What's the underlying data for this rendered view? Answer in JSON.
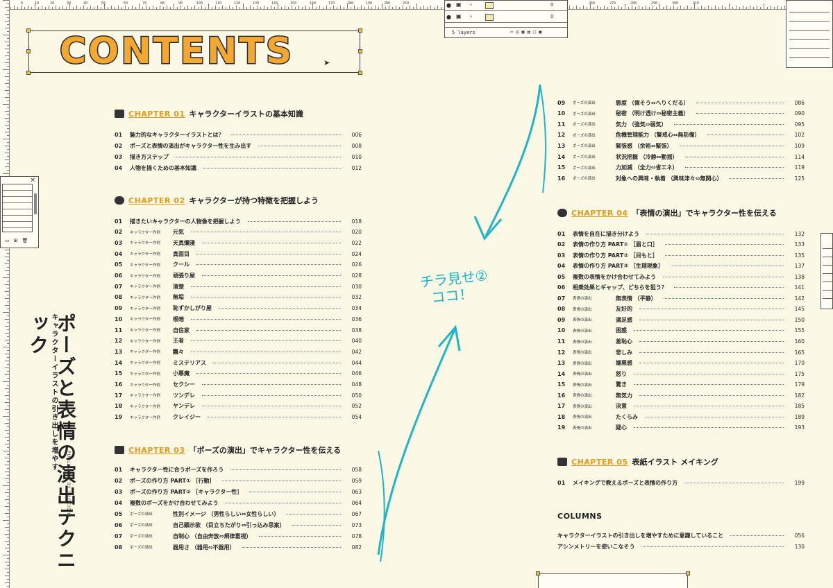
{
  "ruler": {
    "top_numbers": [
      "0",
      "10",
      "20",
      "30",
      "40",
      "50",
      "60",
      "70",
      "80",
      "90",
      "100",
      "110",
      "120",
      "130",
      "140",
      "150",
      "160",
      "170",
      "180",
      "190",
      "200",
      "250",
      "260",
      "270",
      "280",
      "290",
      "300",
      "310"
    ]
  },
  "layers_panel": {
    "rows": [
      {
        "number": "0"
      },
      {
        "number": "0"
      }
    ],
    "footer": "5 layers"
  },
  "left_window": {
    "close": "×"
  },
  "title": "CONTENTS",
  "side": {
    "sub": "キャラクターイラストの引き出しを増やす",
    "main": "ポーズと表情の演出テクニック",
    "publisher": "PUBLISHED BY SHOEISHA"
  },
  "annotation": {
    "line1": "チラ見せ②",
    "line2": "ココ！"
  },
  "chapters": [
    {
      "label": "CHAPTER 01",
      "title": "キャラクターイラストの基本知識",
      "items": [
        {
          "num": "01",
          "tag": "",
          "text": "魅力的なキャラクターイラストとは？",
          "page": "006"
        },
        {
          "num": "02",
          "tag": "",
          "text": "ポーズと表情の演出がキャラクター性を生み出す",
          "page": "008"
        },
        {
          "num": "03",
          "tag": "",
          "text": "描き方ステップ",
          "page": "010"
        },
        {
          "num": "04",
          "tag": "",
          "text": "人物を描くための基本知識",
          "page": "012"
        }
      ]
    },
    {
      "label": "CHAPTER 02",
      "title": "キャラクターが持つ特徴を把握しよう",
      "items": [
        {
          "num": "01",
          "tag": "",
          "text": "描きたいキャラクターの人物像を把握しよう",
          "page": "018"
        },
        {
          "num": "02",
          "tag": "キャラクター作例",
          "text": "元気",
          "page": "020"
        },
        {
          "num": "03",
          "tag": "キャラクター作例",
          "text": "天真爛漫",
          "page": "022"
        },
        {
          "num": "04",
          "tag": "キャラクター作例",
          "text": "真面目",
          "page": "024"
        },
        {
          "num": "05",
          "tag": "キャラクター作例",
          "text": "クール",
          "page": "026"
        },
        {
          "num": "06",
          "tag": "キャラクター作例",
          "text": "頑張り屋",
          "page": "028"
        },
        {
          "num": "07",
          "tag": "キャラクター作例",
          "text": "清楚",
          "page": "030"
        },
        {
          "num": "08",
          "tag": "キャラクター作例",
          "text": "無垢",
          "page": "032"
        },
        {
          "num": "09",
          "tag": "キャラクター作例",
          "text": "恥ずかしがり屋",
          "page": "034"
        },
        {
          "num": "10",
          "tag": "キャラクター作例",
          "text": "根暗",
          "page": "036"
        },
        {
          "num": "11",
          "tag": "キャラクター作例",
          "text": "自信家",
          "page": "038"
        },
        {
          "num": "12",
          "tag": "キャラクター作例",
          "text": "王者",
          "page": "040"
        },
        {
          "num": "13",
          "tag": "キャラクター作例",
          "text": "飄々",
          "page": "042"
        },
        {
          "num": "14",
          "tag": "キャラクター作例",
          "text": "ミステリアス",
          "page": "044"
        },
        {
          "num": "15",
          "tag": "キャラクター作例",
          "text": "小悪魔",
          "page": "046"
        },
        {
          "num": "16",
          "tag": "キャラクター作例",
          "text": "セクシー",
          "page": "048"
        },
        {
          "num": "17",
          "tag": "キャラクター作例",
          "text": "ツンデレ",
          "page": "050"
        },
        {
          "num": "18",
          "tag": "キャラクター作例",
          "text": "ヤンデレ",
          "page": "052"
        },
        {
          "num": "19",
          "tag": "キャラクター作例",
          "text": "クレイジー",
          "page": "054"
        }
      ]
    },
    {
      "label": "CHAPTER 03",
      "title": "「ポーズの演出」でキャラクター性を伝える",
      "items": [
        {
          "num": "01",
          "tag": "",
          "text": "キャラクター性に合うポーズを作ろう",
          "page": "058"
        },
        {
          "num": "02",
          "tag": "",
          "text": "ポーズの作り方 PART① ［行動］",
          "page": "059"
        },
        {
          "num": "03",
          "tag": "",
          "text": "ポーズの作り方 PART② ［キャラクター性］",
          "page": "063"
        },
        {
          "num": "04",
          "tag": "",
          "text": "複数のポーズをかけ合わせてみよう",
          "page": "064"
        },
        {
          "num": "05",
          "tag": "ポーズの演出",
          "text": "性別イメージ （男性らしい⇔女性らしい）",
          "page": "067"
        },
        {
          "num": "06",
          "tag": "ポーズの演出",
          "text": "自己顕示欲 （目立ちたがり⇔引っ込み思案）",
          "page": "073"
        },
        {
          "num": "07",
          "tag": "ポーズの演出",
          "text": "自制心 （自由奔放⇔規律重視）",
          "page": "078"
        },
        {
          "num": "08",
          "tag": "ポーズの演出",
          "text": "器用さ （器用⇔不器用）",
          "page": "082"
        }
      ]
    },
    {
      "label": "",
      "title": "",
      "items": [
        {
          "num": "09",
          "tag": "ポーズの演出",
          "text": "態度 （偉そう⇔へりくだる）",
          "page": "086"
        },
        {
          "num": "10",
          "tag": "ポーズの演出",
          "text": "秘密 （明け透け⇔秘密主義）",
          "page": "090"
        },
        {
          "num": "11",
          "tag": "ポーズの演出",
          "text": "気力 （強気⇔弱気）",
          "page": "095"
        },
        {
          "num": "12",
          "tag": "ポーズの演出",
          "text": "危機管理能力 （警戒心⇔無防備）",
          "page": "102"
        },
        {
          "num": "13",
          "tag": "ポーズの演出",
          "text": "緊張感 （余裕⇔緊張）",
          "page": "109"
        },
        {
          "num": "14",
          "tag": "ポーズの演出",
          "text": "状況把握 （冷静⇔動揺）",
          "page": "114"
        },
        {
          "num": "15",
          "tag": "ポーズの演出",
          "text": "力加減 （全力⇔省エネ）",
          "page": "119"
        },
        {
          "num": "16",
          "tag": "ポーズの演出",
          "text": "対象への興味・執着 （興味津々⇔無関心）",
          "page": "125"
        }
      ]
    },
    {
      "label": "CHAPTER 04",
      "title": "「表情の演出」でキャラクター性を伝える",
      "items": [
        {
          "num": "01",
          "tag": "",
          "text": "表情を自在に描き分けよう",
          "page": "132"
        },
        {
          "num": "02",
          "tag": "",
          "text": "表情の作り方 PART① ［眉と口］",
          "page": "133"
        },
        {
          "num": "03",
          "tag": "",
          "text": "表情の作り方 PART② ［目もと］",
          "page": "135"
        },
        {
          "num": "04",
          "tag": "",
          "text": "表情の作り方 PART③ ［生理現象］",
          "page": "137"
        },
        {
          "num": "05",
          "tag": "",
          "text": "複数の表情をかけ合わせてみよう",
          "page": "138"
        },
        {
          "num": "06",
          "tag": "",
          "text": "相乗効果とギャップ、どちらを狙う？",
          "page": "141"
        },
        {
          "num": "07",
          "tag": "表情の演出",
          "text": "無表情 （平静）",
          "page": "142"
        },
        {
          "num": "08",
          "tag": "表情の演出",
          "text": "友好的",
          "page": "145"
        },
        {
          "num": "09",
          "tag": "表情の演出",
          "text": "満足感",
          "page": "150"
        },
        {
          "num": "10",
          "tag": "表情の演出",
          "text": "困惑",
          "page": "155"
        },
        {
          "num": "11",
          "tag": "表情の演出",
          "text": "羞恥心",
          "page": "160"
        },
        {
          "num": "12",
          "tag": "表情の演出",
          "text": "悲しみ",
          "page": "165"
        },
        {
          "num": "13",
          "tag": "表情の演出",
          "text": "嫌悪感",
          "page": "170"
        },
        {
          "num": "14",
          "tag": "表情の演出",
          "text": "怒り",
          "page": "175"
        },
        {
          "num": "15",
          "tag": "表情の演出",
          "text": "驚き",
          "page": "179"
        },
        {
          "num": "16",
          "tag": "表情の演出",
          "text": "無気力",
          "page": "182"
        },
        {
          "num": "17",
          "tag": "表情の演出",
          "text": "決意",
          "page": "185"
        },
        {
          "num": "18",
          "tag": "表情の演出",
          "text": "たくらみ",
          "page": "189"
        },
        {
          "num": "19",
          "tag": "表情の演出",
          "text": "疑心",
          "page": "193"
        }
      ]
    },
    {
      "label": "CHAPTER 05",
      "title": "表紙イラスト メイキング",
      "items": [
        {
          "num": "01",
          "tag": "",
          "text": "メイキングで教えるポーズと表情の作り方",
          "page": "199"
        }
      ]
    }
  ],
  "columns": {
    "heading": "COLUMNS",
    "items": [
      {
        "text": "キャラクターイラストの引き出しを増やすために意識していること",
        "page": "056"
      },
      {
        "text": "アシンメトリーを使いこなそう",
        "page": "130"
      }
    ]
  },
  "colors": {
    "accent": "#f2a831",
    "annotation": "#1fb5c6",
    "background": "#fbf9e6"
  }
}
